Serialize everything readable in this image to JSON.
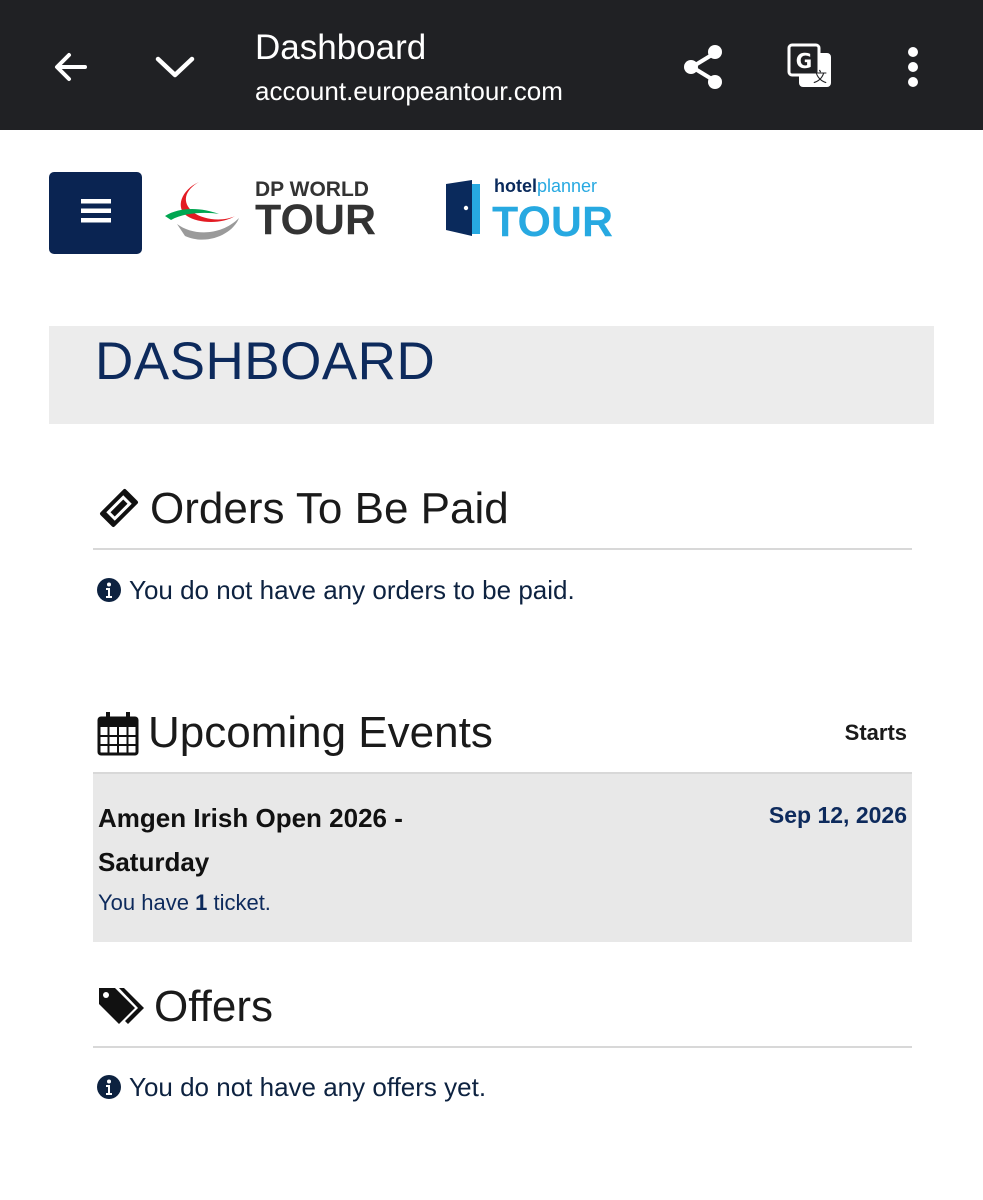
{
  "browser": {
    "title": "Dashboard",
    "url": "account.europeantour.com",
    "icons": [
      "back-arrow-icon",
      "chevron-down-icon",
      "share-icon",
      "translate-icon",
      "more-vert-icon"
    ]
  },
  "header": {
    "logos": [
      {
        "name": "DP WORLD TOUR",
        "line1": "DP WORLD",
        "line2": "TOUR"
      },
      {
        "name": "hotelplanner TOUR",
        "line1a": "hotel",
        "line1b": "planner",
        "line2": "TOUR"
      }
    ],
    "colors": {
      "menu_bg": "#0a2452",
      "hp_blue": "#27a9e1"
    }
  },
  "dashboard": {
    "title": "DASHBOARD"
  },
  "orders": {
    "title": "Orders To Be Paid",
    "empty_message": "You do not have any orders to be paid.",
    "icon": "ticket-icon"
  },
  "events": {
    "title": "Upcoming Events",
    "starts_label": "Starts",
    "icon": "calendar-icon",
    "items": [
      {
        "name": "Amgen Irish Open 2026 - Saturday",
        "date": "Sep 12, 2026",
        "tickets_prefix": "You have",
        "tickets_count": "1",
        "tickets_suffix": "ticket."
      }
    ]
  },
  "offers": {
    "title": "Offers",
    "empty_message": "You do not have any offers yet.",
    "icon": "tags-icon"
  }
}
